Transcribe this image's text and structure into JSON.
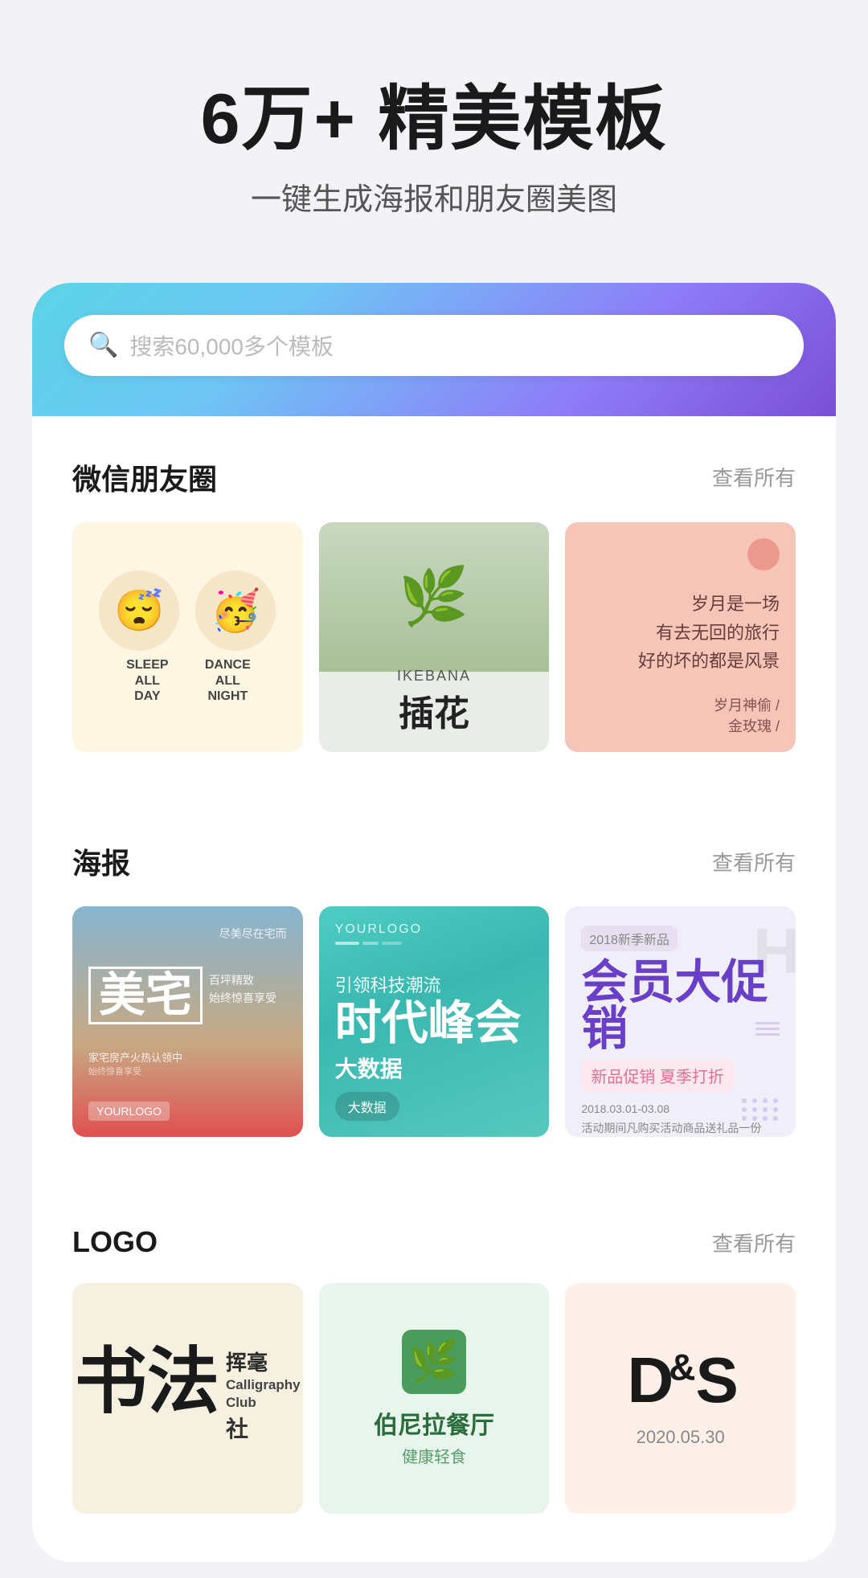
{
  "hero": {
    "title": "6万+ 精美模板",
    "subtitle": "一键生成海报和朋友圈美图"
  },
  "search": {
    "placeholder": "搜索60,000多个模板"
  },
  "sections": {
    "wechat": {
      "title": "微信朋友圈",
      "link": "查看所有"
    },
    "poster": {
      "title": "海报",
      "link": "查看所有"
    },
    "logo": {
      "title": "LOGO",
      "link": "查看所有"
    }
  },
  "wechat_templates": [
    {
      "id": "sleep-dance",
      "emoji1": "😴",
      "emoji2": "🥳",
      "label1": "SLEEP\nALL\nDAY",
      "label2": "DANCE\nALL\nNIGHT"
    },
    {
      "id": "ikebana",
      "en": "IKEBANA",
      "zh": "插花"
    },
    {
      "id": "poem",
      "line1": "岁月是一场",
      "line2": "有去无回的旅行",
      "line3": "好的坏的都是风景",
      "author": "岁月神偷 /",
      "author2": "金玫瑰 /"
    }
  ],
  "poster_templates": [
    {
      "id": "meizhai",
      "big": "美宅",
      "small1": "尽美尽在宅而",
      "small2": "百坪精致",
      "small3": "始终惊喜享受",
      "bottom": "家宅房产火热认领中"
    },
    {
      "id": "bigdata",
      "sub": "引领科技潮流",
      "title": "时代峰会",
      "pre": "大数据",
      "label": "大数据"
    },
    {
      "id": "member",
      "year": "2018新季新品",
      "title": "会员大促销",
      "sub": "新品促销 夏季打折",
      "desc": "2018.03.01-03.08\n活动期间凡购买活动商品送礼品一份\n活动有效期至活动结束止"
    }
  ],
  "logo_templates": [
    {
      "id": "calligraphy",
      "zh": "书法",
      "pre": "挥毫",
      "en1": "Calligraphy",
      "en2": "Club",
      "zh2": "社"
    },
    {
      "id": "restaurant",
      "name": "伯尼拉餐厅",
      "sub": "健康轻食"
    },
    {
      "id": "ds",
      "logo": "D&S",
      "date": "2020.05.30"
    }
  ]
}
